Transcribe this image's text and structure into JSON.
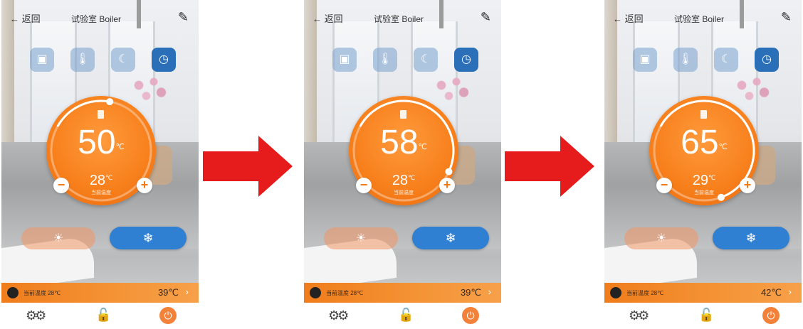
{
  "screens": [
    {
      "back_label": "← 返回",
      "title": "试验室 Boiler",
      "setpoint": "50",
      "setpoint_unit": "℃",
      "current_temp": "28",
      "current_unit": "℃",
      "current_label": "当前温度",
      "status_label": "当前温度 28℃",
      "status_value": "39℃",
      "dial_progress": 0.05
    },
    {
      "back_label": "← 返回",
      "title": "试验室 Boiler",
      "setpoint": "58",
      "setpoint_unit": "℃",
      "current_temp": "28",
      "current_unit": "℃",
      "current_label": "当前温度",
      "status_label": "当前温度 28℃",
      "status_value": "39℃",
      "dial_progress": 0.4
    },
    {
      "back_label": "← 返回",
      "title": "试验室 Boiler",
      "setpoint": "65",
      "setpoint_unit": "℃",
      "current_temp": "29",
      "current_unit": "℃",
      "current_label": "当前温度",
      "status_label": "当前温度 28℃",
      "status_value": "42℃",
      "dial_progress": 0.55
    }
  ],
  "icons": {
    "modes": [
      "suitcase-icon",
      "thermometer-icon",
      "moon-icon",
      "clock-icon"
    ],
    "heat": "sun-icon",
    "cool": "snowflake-icon",
    "settings": "gears-icon",
    "lock": "lock-icon",
    "power": "power-icon"
  },
  "colors": {
    "accent_orange": "#f77f1b",
    "active_blue": "#2a6fb8",
    "cool_button": "#2f7fd3",
    "arrow_red": "#e61b1b"
  }
}
